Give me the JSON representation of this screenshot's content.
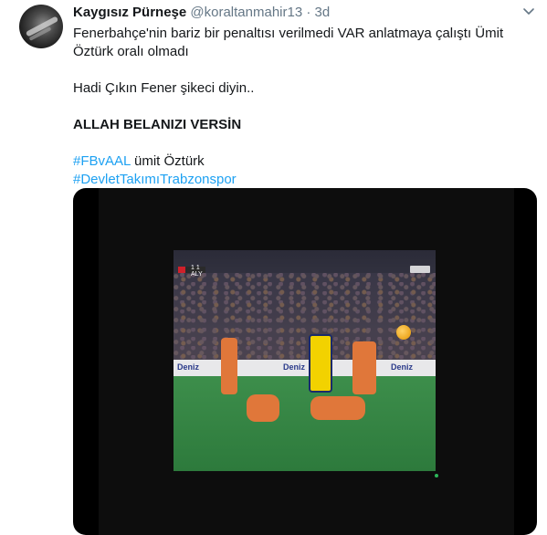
{
  "tweet": {
    "author_name": "Kaygısız Pürneşe",
    "handle": "@koraltanmahir13",
    "separator": "·",
    "time": "3d",
    "avatar_icon": "avatar-photo",
    "menu_icon": "chevron-down-icon",
    "lines": {
      "line1": "Fenerbahçe'nin bariz bir penaltısı verilmedi VAR anlatmaya çalıştı Ümit Öztürk oralı olmadı",
      "line2": "Hadi Çıkın Fener şikeci diyin..",
      "line3": "ALLAH BELANIZI VERSİN",
      "hashtag1": "#FBvAAL",
      "hashtag1_suffix": " ümit Öztürk",
      "hashtag2": "#DevletTakımıTrabzonspor"
    },
    "hashtag_color": "#1da1f2"
  },
  "media": {
    "type": "video",
    "scoreboard_text": "1 1 ALY",
    "sponsor_text": "Deniz"
  }
}
